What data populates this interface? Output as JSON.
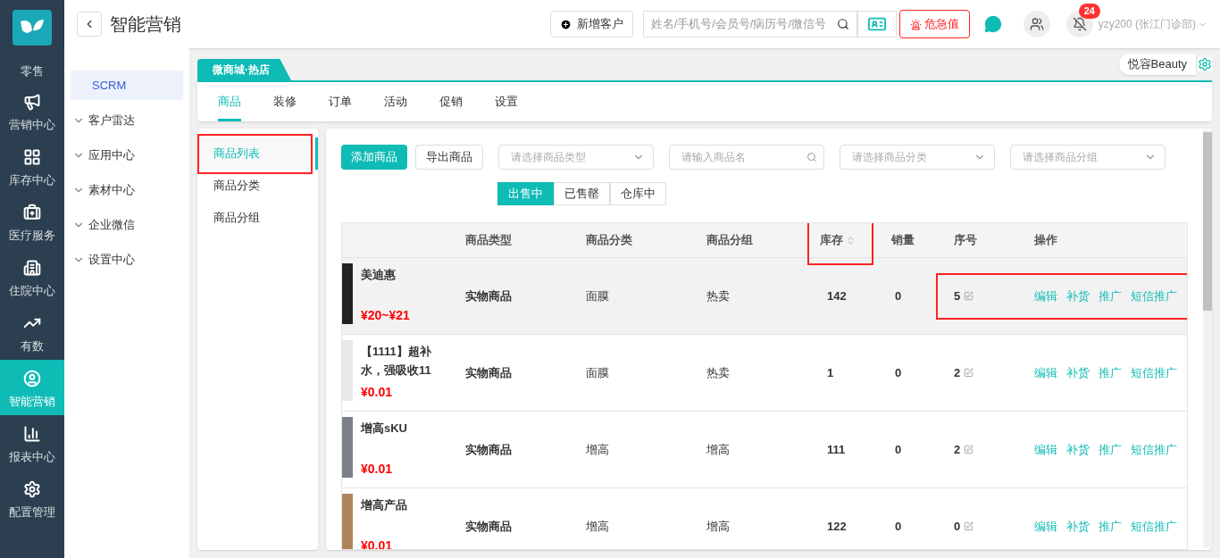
{
  "header": {
    "title": "智能营销",
    "add_customer": "新增客户",
    "search": {
      "placeholder": "姓名/手机号/会员号/病历号/微信号"
    },
    "alert": "危急值",
    "notifications": "24",
    "user": "yzy200 (张江门诊部)"
  },
  "nav": [
    {
      "label": "零售",
      "selected": false
    },
    {
      "label": "营销中心",
      "selected": false
    },
    {
      "label": "库存中心",
      "selected": false
    },
    {
      "label": "医疗服务",
      "selected": false
    },
    {
      "label": "住院中心",
      "selected": false
    },
    {
      "label": "有数",
      "selected": false
    },
    {
      "label": "智能营销",
      "selected": true
    },
    {
      "label": "报表中心",
      "selected": false
    },
    {
      "label": "配置管理",
      "selected": false
    }
  ],
  "sidebar": {
    "items": [
      {
        "label": "SCRM",
        "selected": true
      },
      {
        "label": "客户雷达",
        "selected": false,
        "expanded": false
      },
      {
        "label": "应用中心",
        "selected": false,
        "expanded": false
      },
      {
        "label": "素材中心",
        "selected": false,
        "expanded": false
      },
      {
        "label": "企业微信",
        "selected": false,
        "expanded": false
      },
      {
        "label": "设置中心",
        "selected": false,
        "expanded": false
      }
    ]
  },
  "store_tab": "微商城·热店",
  "store_select": "悦容Beauty",
  "tabs": [
    {
      "label": "商品",
      "selected": true
    },
    {
      "label": "装修",
      "selected": false
    },
    {
      "label": "订单",
      "selected": false
    },
    {
      "label": "活动",
      "selected": false
    },
    {
      "label": "促销",
      "selected": false
    },
    {
      "label": "设置",
      "selected": false
    }
  ],
  "submenu": [
    {
      "label": "商品列表",
      "selected": true,
      "highlighted": true
    },
    {
      "label": "商品分类",
      "selected": false,
      "highlighted": false
    },
    {
      "label": "商品分组",
      "selected": false,
      "highlighted": false
    }
  ],
  "toolbar": {
    "add": "添加商品",
    "export": "导出商品",
    "filters": [
      {
        "kind": "select",
        "placeholder": "请选择商品类型"
      },
      {
        "kind": "search",
        "placeholder": "请输入商品名"
      },
      {
        "kind": "select",
        "placeholder": "请选择商品分类"
      },
      {
        "kind": "select",
        "placeholder": "请选择商品分组"
      }
    ]
  },
  "status_tabs": [
    {
      "label": "出售中",
      "selected": true
    },
    {
      "label": "已售罄",
      "selected": false
    },
    {
      "label": "仓库中",
      "selected": false
    }
  ],
  "table": {
    "columns": [
      {
        "label": "商品类型",
        "sortable": false,
        "highlighted": false
      },
      {
        "label": "商品分类",
        "sortable": false,
        "highlighted": false
      },
      {
        "label": "商品分组",
        "sortable": false,
        "highlighted": false
      },
      {
        "label": "库存",
        "sortable": true,
        "highlighted": true
      },
      {
        "label": "销量",
        "sortable": false,
        "highlighted": false
      },
      {
        "label": "序号",
        "sortable": false,
        "highlighted": false
      },
      {
        "label": "操作",
        "sortable": false,
        "highlighted": false
      }
    ],
    "rows": [
      {
        "name": "美迪惠",
        "price": "¥20~¥21",
        "type": "实物商品",
        "category": "面膜",
        "group": "热卖",
        "stock": "142",
        "sales": "0",
        "order": "5",
        "actions": [
          "编辑",
          "补货",
          "推广",
          "短信推广"
        ],
        "hovered": true,
        "highlighted": true
      },
      {
        "name": "【1111】超补水，强吸收11",
        "price": "¥0.01",
        "type": "实物商品",
        "category": "面膜",
        "group": "热卖",
        "stock": "1",
        "sales": "0",
        "order": "2",
        "actions": [
          "编辑",
          "补货",
          "推广",
          "短信推广"
        ],
        "hovered": false,
        "highlighted": false
      },
      {
        "name": "增高sKU",
        "price": "¥0.01",
        "type": "实物商品",
        "category": "增高",
        "group": "增高",
        "stock": "111",
        "sales": "0",
        "order": "2",
        "actions": [
          "编辑",
          "补货",
          "推广",
          "短信推广"
        ],
        "hovered": false,
        "highlighted": false
      },
      {
        "name": "增高产品",
        "price": "¥0.01",
        "type": "实物商品",
        "category": "增高",
        "group": "增高",
        "stock": "122",
        "sales": "0",
        "order": "0",
        "actions": [
          "编辑",
          "补货",
          "推广",
          "短信推广"
        ],
        "hovered": false,
        "highlighted": false
      }
    ]
  }
}
